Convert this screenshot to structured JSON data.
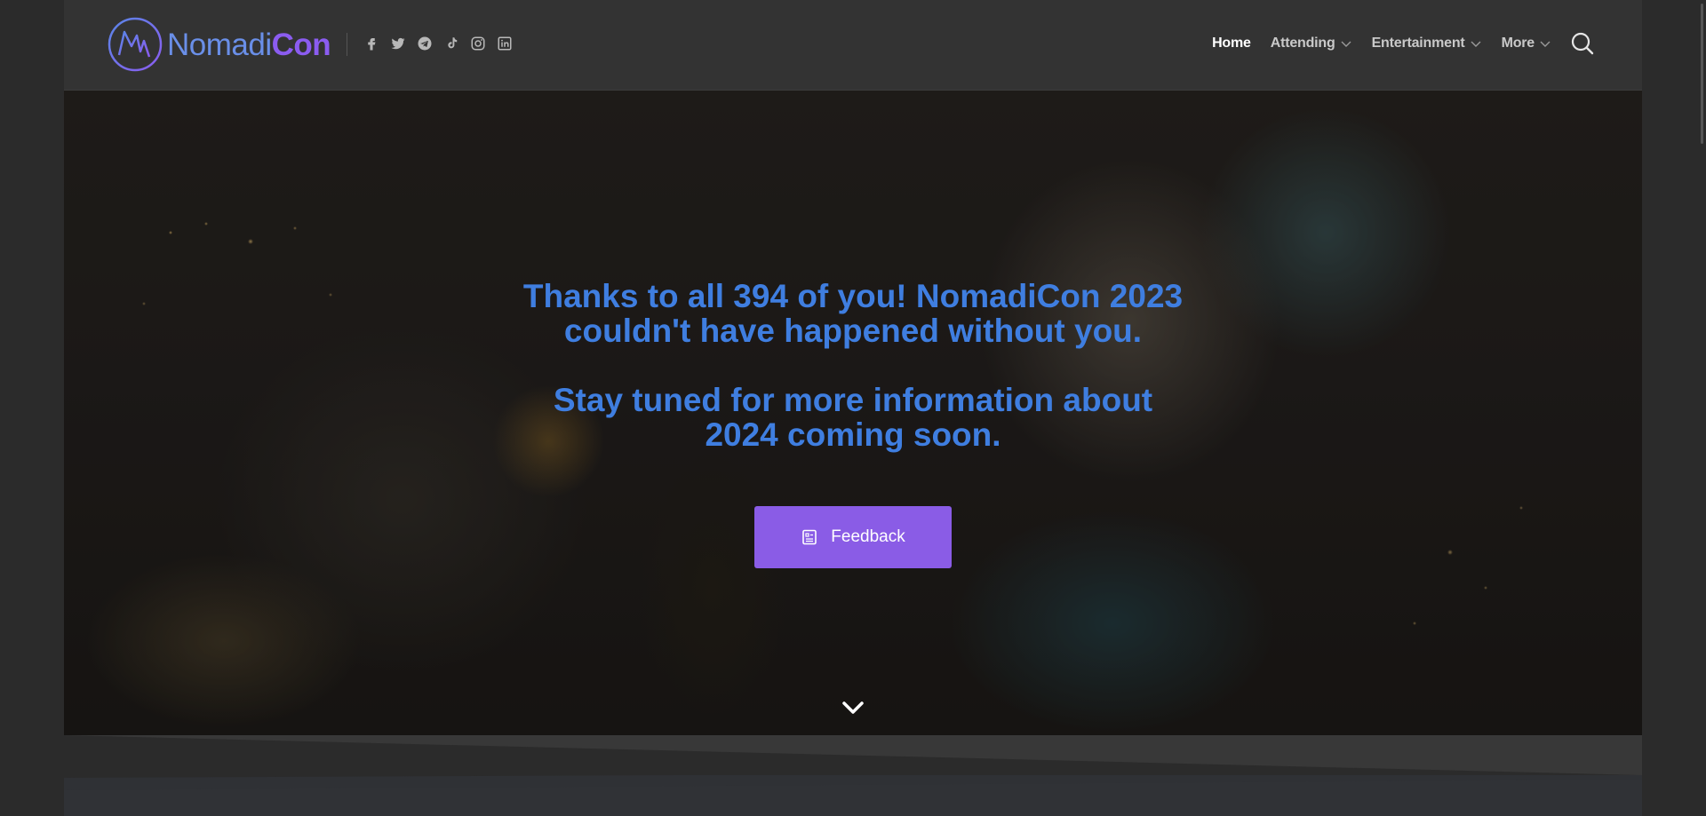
{
  "brand": {
    "name_part1": "Nomadi",
    "name_part2": "Con",
    "primary_color": "#6a8fe8",
    "accent_color": "#8b5cf0"
  },
  "socials": [
    {
      "icon": "facebook-icon"
    },
    {
      "icon": "twitter-icon"
    },
    {
      "icon": "telegram-icon"
    },
    {
      "icon": "tiktok-icon"
    },
    {
      "icon": "instagram-icon"
    },
    {
      "icon": "linkedin-icon"
    }
  ],
  "nav": {
    "home": "Home",
    "attending": "Attending",
    "entertainment": "Entertainment",
    "more": "More",
    "search_icon": "search-icon"
  },
  "hero": {
    "headline1_line1": "Thanks to all 394 of you! NomadiCon 2023",
    "headline1_line2": "couldn't have happened without you.",
    "headline2_line1": "Stay tuned for more information about",
    "headline2_line2": "2024 coming soon.",
    "headline_color": "#3f7ee0",
    "button_label": "Feedback",
    "button_color": "#8a5ce6",
    "button_icon": "form-icon",
    "scroll_icon": "chevron-down-icon"
  }
}
